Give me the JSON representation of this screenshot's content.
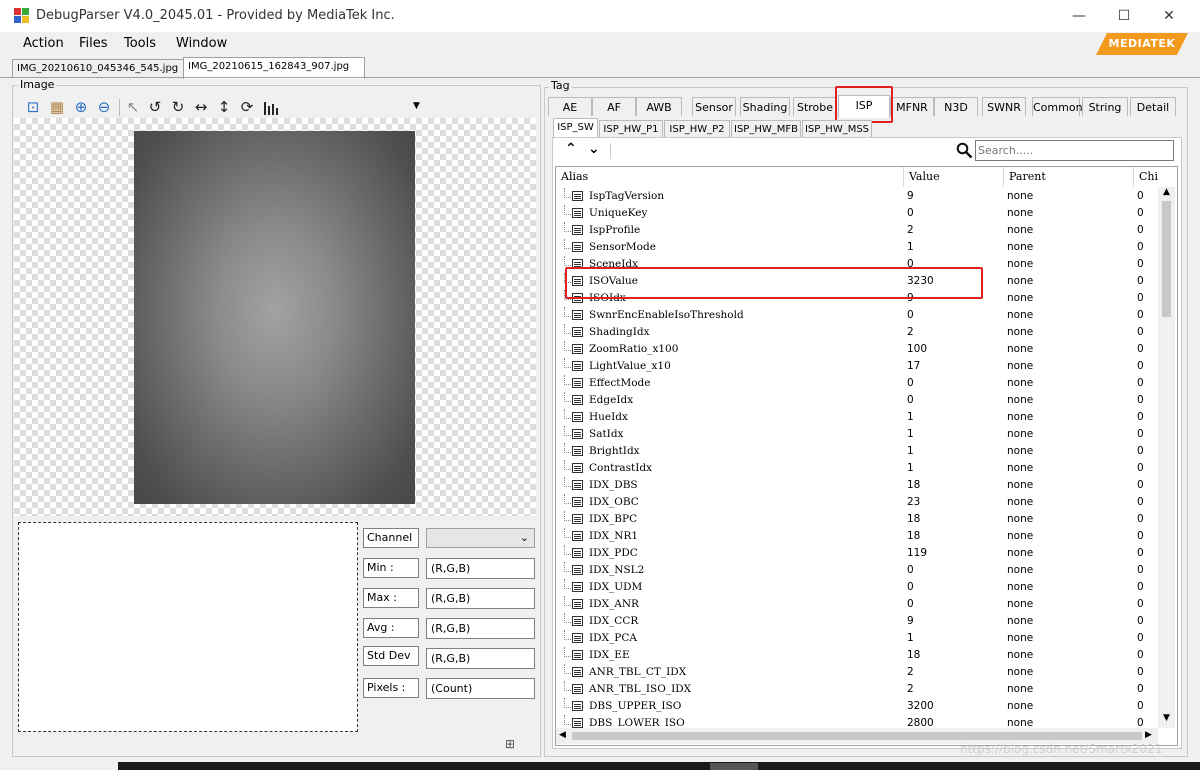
{
  "window": {
    "title": "DebugParser V4.0_2045.01 - Provided by MediaTek Inc.",
    "minimize": "—",
    "maximize": "☐",
    "close": "✕"
  },
  "menu": [
    "Action",
    "Files",
    "Tools",
    "Window"
  ],
  "brand": "MEDIATEK",
  "file_tabs": [
    "IMG_20210610_045346_545.jpg",
    "IMG_20210615_162843_907.jpg"
  ],
  "image_panel": {
    "label": "Image",
    "toolbar_icons": [
      "fit-screen-icon",
      "thumbnail-icon",
      "zoom-in-icon",
      "zoom-out-icon",
      "pointer-icon",
      "rotate-left-icon",
      "rotate-right-icon",
      "flip-horizontal-icon",
      "flip-vertical-icon",
      "refresh-icon",
      "histogram-icon",
      "dropdown-arrow-icon"
    ],
    "stats": [
      {
        "label": "Min :",
        "value": "(R,G,B)"
      },
      {
        "label": "Max :",
        "value": "(R,G,B)"
      },
      {
        "label": "Avg :",
        "value": "(R,G,B)"
      },
      {
        "label": "Std Dev",
        "value": "(R,G,B)"
      },
      {
        "label": "Pixels :",
        "value": "(Count)"
      }
    ],
    "channel_label": "Channel",
    "channel_value": ""
  },
  "tag_panel": {
    "label": "Tag",
    "tabs": [
      "AE",
      "AF",
      "AWB",
      "Sensor",
      "Shading",
      "Strobe",
      "ISP",
      "MFNR",
      "N3D",
      "SWNR",
      "Common",
      "String",
      "Detail"
    ],
    "active_tab": "ISP",
    "sub_tabs": [
      "ISP_SW",
      "ISP_HW_P1",
      "ISP_HW_P2",
      "ISP_HW_MFB",
      "ISP_HW_MSS"
    ],
    "active_sub_tab": "ISP_SW",
    "search_placeholder": "Search.....",
    "columns": [
      "Alias",
      "Value",
      "Parent",
      "Chi"
    ],
    "rows": [
      {
        "alias": "IspTagVersion",
        "value": "9",
        "parent": "none",
        "child": "0"
      },
      {
        "alias": "UniqueKey",
        "value": "0",
        "parent": "none",
        "child": "0"
      },
      {
        "alias": "IspProfile",
        "value": "2",
        "parent": "none",
        "child": "0"
      },
      {
        "alias": "SensorMode",
        "value": "1",
        "parent": "none",
        "child": "0"
      },
      {
        "alias": "SceneIdx",
        "value": "0",
        "parent": "none",
        "child": "0"
      },
      {
        "alias": "ISOValue",
        "value": "3230",
        "parent": "none",
        "child": "0"
      },
      {
        "alias": "ISOIdx",
        "value": "9",
        "parent": "none",
        "child": "0"
      },
      {
        "alias": "SwnrEncEnableIsoThreshold",
        "value": "0",
        "parent": "none",
        "child": "0"
      },
      {
        "alias": "ShadingIdx",
        "value": "2",
        "parent": "none",
        "child": "0"
      },
      {
        "alias": "ZoomRatio_x100",
        "value": "100",
        "parent": "none",
        "child": "0"
      },
      {
        "alias": "LightValue_x10",
        "value": "17",
        "parent": "none",
        "child": "0"
      },
      {
        "alias": "EffectMode",
        "value": "0",
        "parent": "none",
        "child": "0"
      },
      {
        "alias": "EdgeIdx",
        "value": "0",
        "parent": "none",
        "child": "0"
      },
      {
        "alias": "HueIdx",
        "value": "1",
        "parent": "none",
        "child": "0"
      },
      {
        "alias": "SatIdx",
        "value": "1",
        "parent": "none",
        "child": "0"
      },
      {
        "alias": "BrightIdx",
        "value": "1",
        "parent": "none",
        "child": "0"
      },
      {
        "alias": "ContrastIdx",
        "value": "1",
        "parent": "none",
        "child": "0"
      },
      {
        "alias": "IDX_DBS",
        "value": "18",
        "parent": "none",
        "child": "0"
      },
      {
        "alias": "IDX_OBC",
        "value": "23",
        "parent": "none",
        "child": "0"
      },
      {
        "alias": "IDX_BPC",
        "value": "18",
        "parent": "none",
        "child": "0"
      },
      {
        "alias": "IDX_NR1",
        "value": "18",
        "parent": "none",
        "child": "0"
      },
      {
        "alias": "IDX_PDC",
        "value": "119",
        "parent": "none",
        "child": "0"
      },
      {
        "alias": "IDX_NSL2",
        "value": "0",
        "parent": "none",
        "child": "0"
      },
      {
        "alias": "IDX_UDM",
        "value": "0",
        "parent": "none",
        "child": "0"
      },
      {
        "alias": "IDX_ANR",
        "value": "0",
        "parent": "none",
        "child": "0"
      },
      {
        "alias": "IDX_CCR",
        "value": "9",
        "parent": "none",
        "child": "0"
      },
      {
        "alias": "IDX_PCA",
        "value": "1",
        "parent": "none",
        "child": "0"
      },
      {
        "alias": "IDX_EE",
        "value": "18",
        "parent": "none",
        "child": "0"
      },
      {
        "alias": "ANR_TBL_CT_IDX",
        "value": "2",
        "parent": "none",
        "child": "0"
      },
      {
        "alias": "ANR_TBL_ISO_IDX",
        "value": "2",
        "parent": "none",
        "child": "0"
      },
      {
        "alias": "DBS_UPPER_ISO",
        "value": "3200",
        "parent": "none",
        "child": "0"
      },
      {
        "alias": "DBS_LOWER_ISO",
        "value": "2800",
        "parent": "none",
        "child": "0"
      }
    ]
  },
  "watermark": "https://blog.csdn.net/Smartx2021"
}
